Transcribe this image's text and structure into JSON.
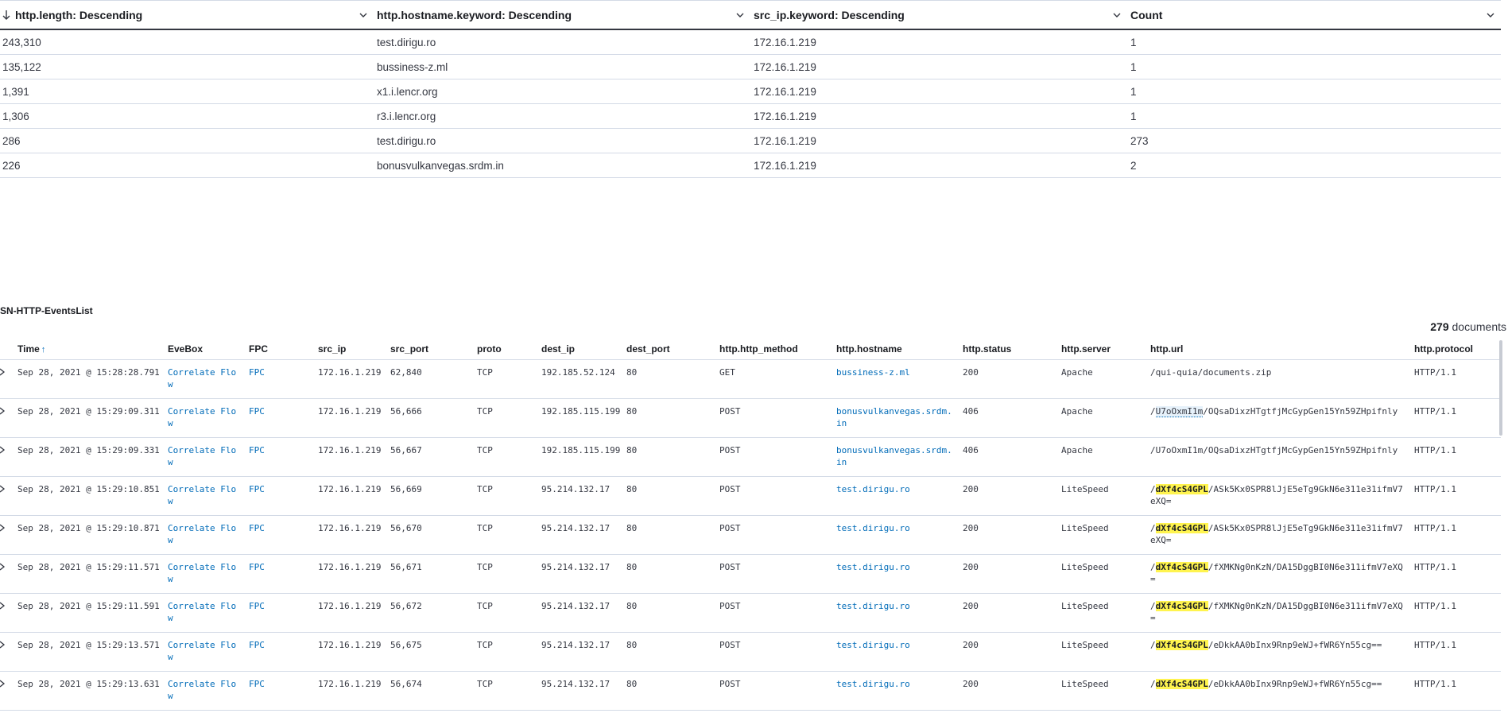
{
  "agg_table": {
    "headers": [
      "http.length: Descending",
      "http.hostname.keyword: Descending",
      "src_ip.keyword: Descending",
      "Count"
    ],
    "rows": [
      [
        "243,310",
        "test.dirigu.ro",
        "172.16.1.219",
        "1"
      ],
      [
        "135,122",
        "bussiness-z.ml",
        "172.16.1.219",
        "1"
      ],
      [
        "1,391",
        "x1.i.lencr.org",
        "172.16.1.219",
        "1"
      ],
      [
        "1,306",
        "r3.i.lencr.org",
        "172.16.1.219",
        "1"
      ],
      [
        "286",
        "test.dirigu.ro",
        "172.16.1.219",
        "273"
      ],
      [
        "226",
        "bonusvulkanvegas.srdm.in",
        "172.16.1.219",
        "2"
      ]
    ]
  },
  "events": {
    "title": "SN-HTTP-EventsList",
    "doc_count": "279",
    "doc_label": "documents",
    "columns": [
      "Time",
      "EveBox",
      "FPC",
      "src_ip",
      "src_port",
      "proto",
      "dest_ip",
      "dest_port",
      "http.http_method",
      "http.hostname",
      "http.status",
      "http.server",
      "http.url",
      "http.protocol"
    ],
    "sort_arrow": "↑",
    "rows": [
      {
        "time": "Sep 28, 2021 @ 15:28:28.791",
        "evebox": "Correlate Flow",
        "fpc": "FPC",
        "src_ip": "172.16.1.219",
        "src_port": "62,840",
        "proto": "TCP",
        "dest_ip": "192.185.52.124",
        "dest_port": "80",
        "method": "GET",
        "hostname": "bussiness-z.ml",
        "status": "200",
        "server": "Apache",
        "url_pre": "/qui-quia/documents.zip",
        "url_hl": "",
        "url_rest": "",
        "protocol": "HTTP/1.1"
      },
      {
        "time": "Sep 28, 2021 @ 15:29:09.311",
        "evebox": "Correlate Flow",
        "fpc": "FPC",
        "src_ip": "172.16.1.219",
        "src_port": "56,666",
        "proto": "TCP",
        "dest_ip": "192.185.115.199",
        "dest_port": "80",
        "method": "POST",
        "hostname": "bonusvulkanvegas.srdm.in",
        "status": "406",
        "server": "Apache",
        "url_pre": "/",
        "url_hl": "",
        "url_ul": "U7oOxmI1m",
        "url_rest": "/OQsaDixzHTgtfjMcGypGen15Yn59ZHpifnly",
        "protocol": "HTTP/1.1"
      },
      {
        "time": "Sep 28, 2021 @ 15:29:09.331",
        "evebox": "Correlate Flow",
        "fpc": "FPC",
        "src_ip": "172.16.1.219",
        "src_port": "56,667",
        "proto": "TCP",
        "dest_ip": "192.185.115.199",
        "dest_port": "80",
        "method": "POST",
        "hostname": "bonusvulkanvegas.srdm.in",
        "status": "406",
        "server": "Apache",
        "url_pre": "/U7oOxmI1m/OQsaDixzHTgtfjMcGypGen15Yn59ZHpifnly",
        "url_hl": "",
        "url_rest": "",
        "protocol": "HTTP/1.1"
      },
      {
        "time": "Sep 28, 2021 @ 15:29:10.851",
        "evebox": "Correlate Flow",
        "fpc": "FPC",
        "src_ip": "172.16.1.219",
        "src_port": "56,669",
        "proto": "TCP",
        "dest_ip": "95.214.132.17",
        "dest_port": "80",
        "method": "POST",
        "hostname": "test.dirigu.ro",
        "status": "200",
        "server": "LiteSpeed",
        "url_pre": "/",
        "url_hl": "dXf4cS4GPL",
        "url_rest": "/ASk5Kx0SPR8lJjE5eTg9GkN6e311e31ifmV7eXQ=",
        "protocol": "HTTP/1.1"
      },
      {
        "time": "Sep 28, 2021 @ 15:29:10.871",
        "evebox": "Correlate Flow",
        "fpc": "FPC",
        "src_ip": "172.16.1.219",
        "src_port": "56,670",
        "proto": "TCP",
        "dest_ip": "95.214.132.17",
        "dest_port": "80",
        "method": "POST",
        "hostname": "test.dirigu.ro",
        "status": "200",
        "server": "LiteSpeed",
        "url_pre": "/",
        "url_hl": "dXf4cS4GPL",
        "url_rest": "/ASk5Kx0SPR8lJjE5eTg9GkN6e311e31ifmV7eXQ=",
        "protocol": "HTTP/1.1"
      },
      {
        "time": "Sep 28, 2021 @ 15:29:11.571",
        "evebox": "Correlate Flow",
        "fpc": "FPC",
        "src_ip": "172.16.1.219",
        "src_port": "56,671",
        "proto": "TCP",
        "dest_ip": "95.214.132.17",
        "dest_port": "80",
        "method": "POST",
        "hostname": "test.dirigu.ro",
        "status": "200",
        "server": "LiteSpeed",
        "url_pre": "/",
        "url_hl": "dXf4cS4GPL",
        "url_rest": "/fXMKNg0nKzN/DA15DggBI0N6e311ifmV7eXQ=",
        "protocol": "HTTP/1.1"
      },
      {
        "time": "Sep 28, 2021 @ 15:29:11.591",
        "evebox": "Correlate Flow",
        "fpc": "FPC",
        "src_ip": "172.16.1.219",
        "src_port": "56,672",
        "proto": "TCP",
        "dest_ip": "95.214.132.17",
        "dest_port": "80",
        "method": "POST",
        "hostname": "test.dirigu.ro",
        "status": "200",
        "server": "LiteSpeed",
        "url_pre": "/",
        "url_hl": "dXf4cS4GPL",
        "url_rest": "/fXMKNg0nKzN/DA15DggBI0N6e311ifmV7eXQ=",
        "protocol": "HTTP/1.1"
      },
      {
        "time": "Sep 28, 2021 @ 15:29:13.571",
        "evebox": "Correlate Flow",
        "fpc": "FPC",
        "src_ip": "172.16.1.219",
        "src_port": "56,675",
        "proto": "TCP",
        "dest_ip": "95.214.132.17",
        "dest_port": "80",
        "method": "POST",
        "hostname": "test.dirigu.ro",
        "status": "200",
        "server": "LiteSpeed",
        "url_pre": "/",
        "url_hl": "dXf4cS4GPL",
        "url_rest": "/eDkkAA0bInx9Rnp9eWJ+fWR6Yn55cg==",
        "protocol": "HTTP/1.1"
      },
      {
        "time": "Sep 28, 2021 @ 15:29:13.631",
        "evebox": "Correlate Flow",
        "fpc": "FPC",
        "src_ip": "172.16.1.219",
        "src_port": "56,674",
        "proto": "TCP",
        "dest_ip": "95.214.132.17",
        "dest_port": "80",
        "method": "POST",
        "hostname": "test.dirigu.ro",
        "status": "200",
        "server": "LiteSpeed",
        "url_pre": "/",
        "url_hl": "dXf4cS4GPL",
        "url_rest": "/eDkkAA0bInx9Rnp9eWJ+fWR6Yn55cg==",
        "protocol": "HTTP/1.1"
      }
    ]
  },
  "colors": {
    "link": "#006bb8",
    "highlight": "#fff44f",
    "border": "#d3dae6",
    "text": "#343741"
  }
}
